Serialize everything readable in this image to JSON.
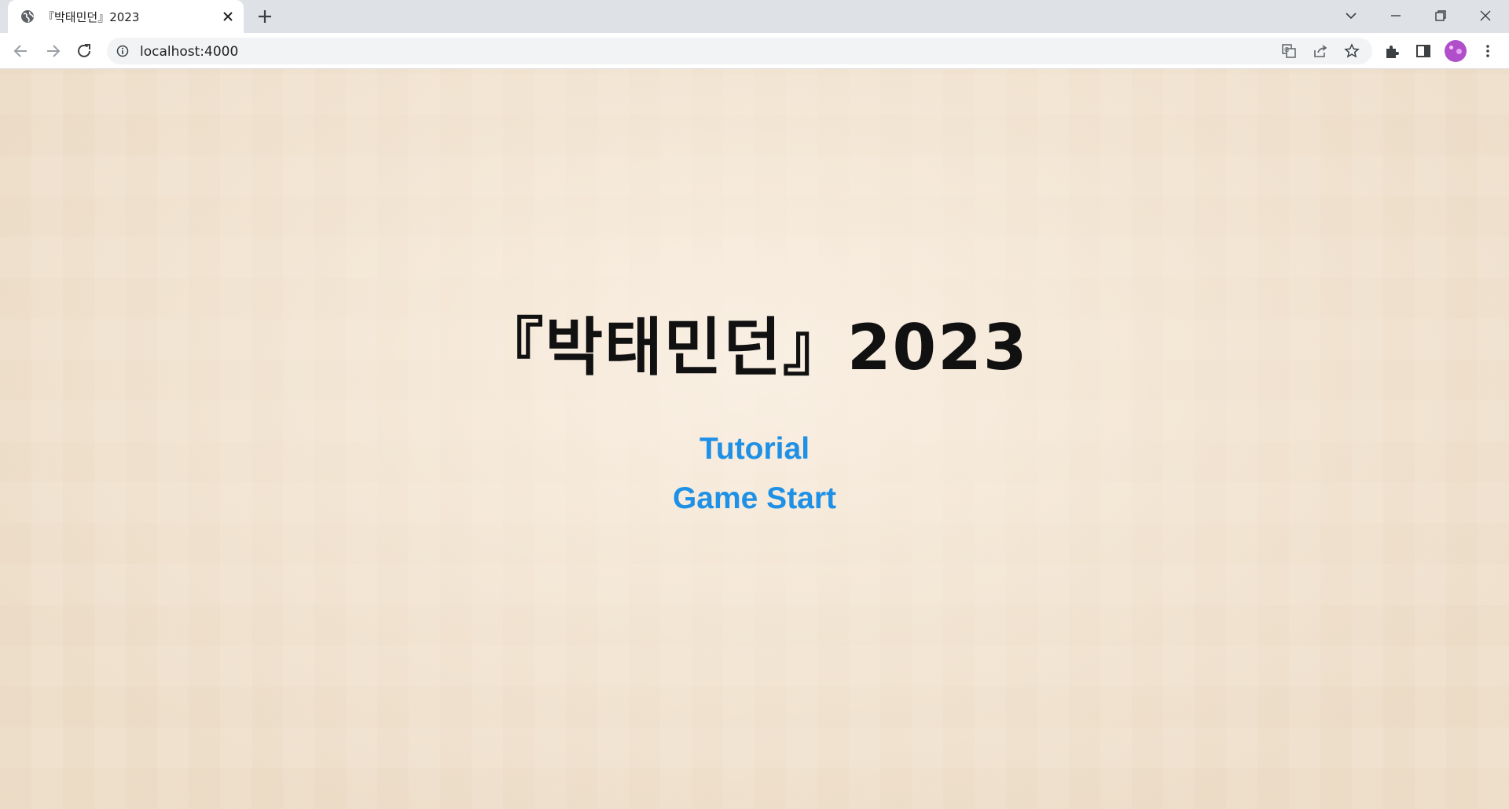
{
  "browser": {
    "tab": {
      "title": "『박태민던』2023"
    },
    "address_bar": {
      "url": "localhost:4000"
    }
  },
  "page": {
    "title": "『박태민던』2023",
    "menu": [
      {
        "label": "Tutorial"
      },
      {
        "label": "Game Start"
      }
    ]
  },
  "colors": {
    "link": "#1e90e6",
    "title": "#111111",
    "background": "#efe1cd",
    "avatar": "#b04fc9"
  },
  "icons": [
    "globe-icon",
    "close-icon",
    "plus-icon",
    "chevron-down-icon",
    "minimize-icon",
    "restore-icon",
    "window-close-icon",
    "back-arrow-icon",
    "forward-arrow-icon",
    "reload-icon",
    "info-icon",
    "translate-icon",
    "share-icon",
    "star-icon",
    "puzzle-icon",
    "side-panel-icon",
    "avatar",
    "kebab-menu-icon"
  ]
}
